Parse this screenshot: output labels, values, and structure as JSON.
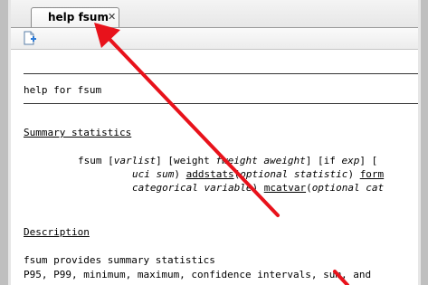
{
  "tab": {
    "label": "help fsum",
    "close_glyph": "✕"
  },
  "toolbar": {
    "new_icon": "new-viewer-icon"
  },
  "doc": {
    "title_prefix": "help for ",
    "title_command": "fsum",
    "summary_heading": "Summary statistics",
    "syntax": {
      "line1": {
        "cmd": "fsum",
        "a": " [",
        "varlist": "varlist",
        "b": "] [",
        "weight": "weight",
        "c": " ",
        "fweight": "fweight aweight",
        "d": "] [if ",
        "exp": "exp",
        "e": "] ["
      },
      "line2": {
        "uci": "uci sum",
        "a": ") ",
        "addstats": "addstats",
        "b": "(",
        "optstat": "optional statistic",
        "c": ") ",
        "form": "form"
      },
      "line3": {
        "catvar": "categorical variable",
        "a": ") ",
        "mcatvar": "mcatvar",
        "b": "(",
        "optcat": "optional cat"
      }
    },
    "description_heading": "Description",
    "desc_line1_cmd": "fsum",
    "desc_line1_rest": " provides summary statistics",
    "desc_line2": "P95, P99, minimum, maximum, confidence intervals, sum, and"
  },
  "colors": {
    "arrow": "#e8121b",
    "rule": "#333333"
  }
}
